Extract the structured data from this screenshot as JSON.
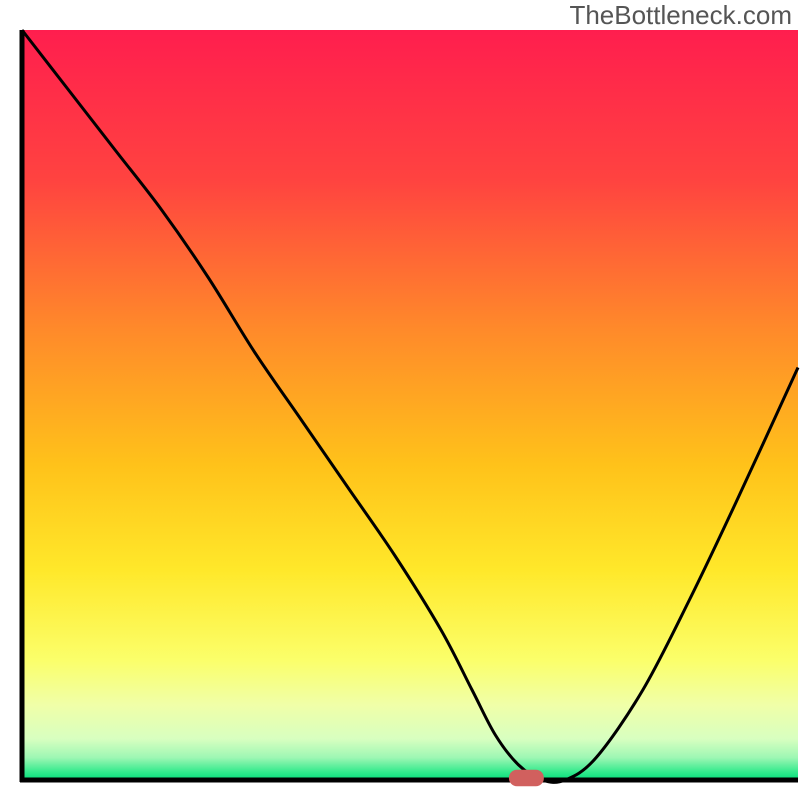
{
  "watermark": "TheBottleneck.com",
  "chart_data": {
    "type": "line",
    "title": "",
    "xlabel": "",
    "ylabel": "",
    "xlim": [
      0,
      100
    ],
    "ylim": [
      0,
      100
    ],
    "x": [
      0,
      6,
      12,
      18,
      24,
      30,
      36,
      42,
      48,
      54,
      58,
      61,
      64,
      67,
      70,
      74,
      80,
      86,
      92,
      100
    ],
    "values": [
      100,
      92,
      84,
      76,
      67,
      57,
      48,
      39,
      30,
      20,
      12,
      6,
      2,
      0,
      0,
      3,
      12,
      24,
      37,
      55
    ],
    "marker": {
      "x": 65,
      "y": 0,
      "width": 4.5,
      "height": 2.2,
      "color": "#d1605e"
    },
    "gradient": {
      "stops": [
        {
          "offset": 0,
          "color": "#ff1e4e"
        },
        {
          "offset": 0.2,
          "color": "#ff4340"
        },
        {
          "offset": 0.4,
          "color": "#ff8a2a"
        },
        {
          "offset": 0.58,
          "color": "#ffc21a"
        },
        {
          "offset": 0.72,
          "color": "#ffe82a"
        },
        {
          "offset": 0.84,
          "color": "#fbff6a"
        },
        {
          "offset": 0.9,
          "color": "#f0ffa8"
        },
        {
          "offset": 0.945,
          "color": "#d8ffc0"
        },
        {
          "offset": 0.97,
          "color": "#9ef7b4"
        },
        {
          "offset": 0.99,
          "color": "#2fe98b"
        },
        {
          "offset": 1.0,
          "color": "#06dd7b"
        }
      ]
    },
    "axis_color": "#000000",
    "line_color": "#000000"
  }
}
